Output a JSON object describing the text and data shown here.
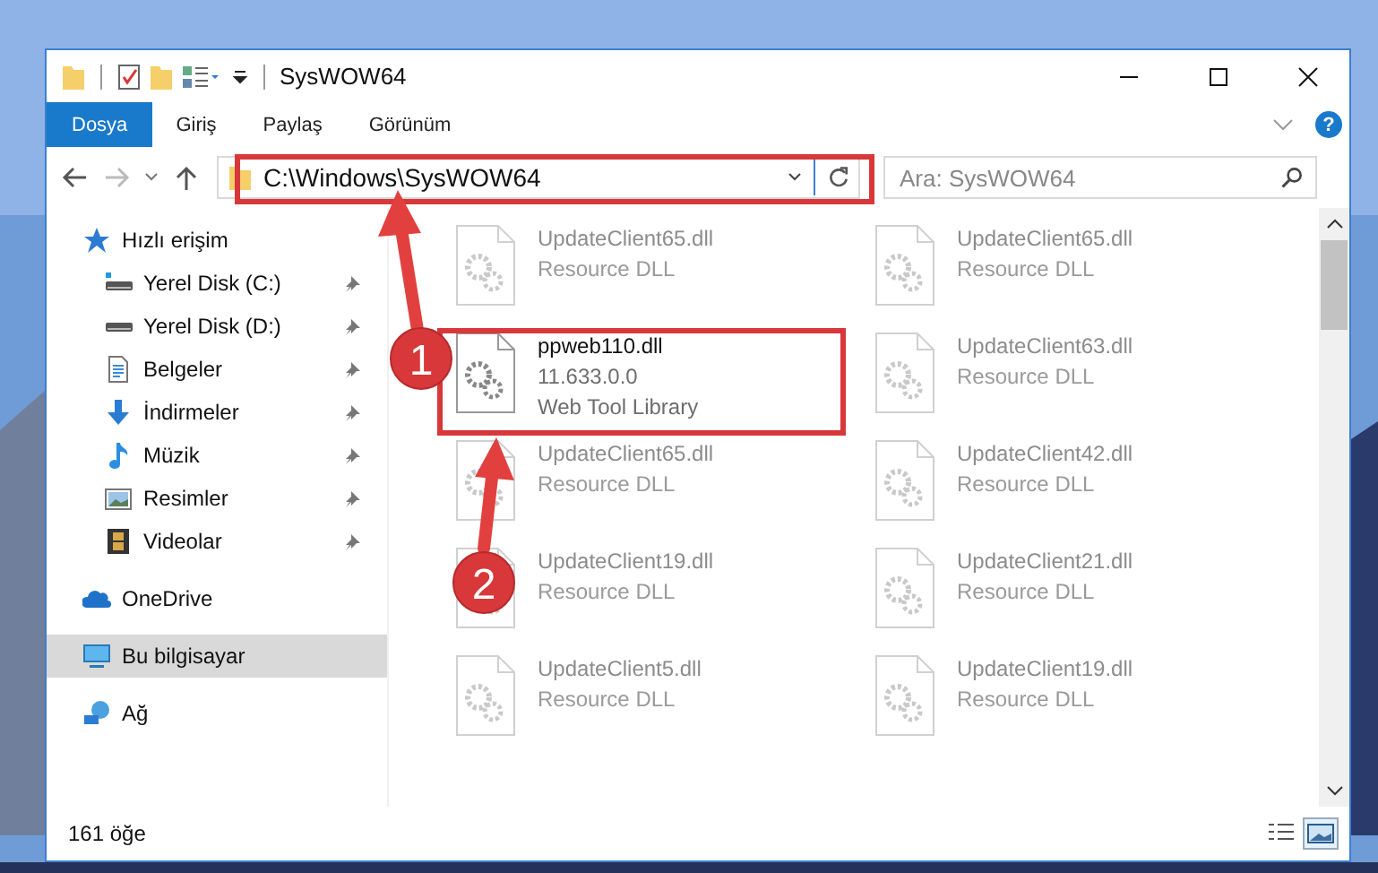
{
  "window": {
    "title": "SysWOW64"
  },
  "ribbon_tabs": [
    {
      "label": "Dosya",
      "selected": true
    },
    {
      "label": "Giriş",
      "selected": false
    },
    {
      "label": "Paylaş",
      "selected": false
    },
    {
      "label": "Görünüm",
      "selected": false
    }
  ],
  "help": "?",
  "address": {
    "path": "C:\\Windows\\SysWOW64"
  },
  "search": {
    "placeholder": "Ara: SysWOW64"
  },
  "sidebar": {
    "sections": [
      {
        "label": "Hızlı erişim",
        "kind": "star",
        "selected": false,
        "children": [
          {
            "label": "Yerel Disk (C:)",
            "kind": "drive-windows",
            "pinned": true,
            "selected": false
          },
          {
            "label": "Yerel Disk (D:)",
            "kind": "drive",
            "pinned": true,
            "selected": false
          },
          {
            "label": "Belgeler",
            "kind": "document",
            "pinned": true,
            "selected": false
          },
          {
            "label": "İndirmeler",
            "kind": "download",
            "pinned": true,
            "selected": false
          },
          {
            "label": "Müzik",
            "kind": "music",
            "pinned": true,
            "selected": false
          },
          {
            "label": "Resimler",
            "kind": "pictures",
            "pinned": true,
            "selected": false
          },
          {
            "label": "Videolar",
            "kind": "videos",
            "pinned": true,
            "selected": false
          }
        ]
      },
      {
        "label": "OneDrive",
        "kind": "cloud",
        "selected": false
      },
      {
        "label": "Bu bilgisayar",
        "kind": "computer",
        "selected": true
      },
      {
        "label": "Ağ",
        "kind": "network",
        "selected": false
      }
    ]
  },
  "files": [
    {
      "name": "UpdateClient65.dll",
      "details": [
        "Resource DLL"
      ],
      "blurred": true
    },
    {
      "name": "UpdateClient65.dll",
      "details": [
        "Resource DLL"
      ],
      "blurred": true
    },
    {
      "name": "ppweb110.dll",
      "details": [
        "11.633.0.0",
        "Web Tool Library"
      ],
      "blurred": false
    },
    {
      "name": "UpdateClient63.dll",
      "details": [
        "Resource DLL"
      ],
      "blurred": true
    },
    {
      "name": "UpdateClient65.dll",
      "details": [
        "Resource DLL"
      ],
      "blurred": true
    },
    {
      "name": "UpdateClient42.dll",
      "details": [
        "Resource DLL"
      ],
      "blurred": true
    },
    {
      "name": "UpdateClient19.dll",
      "details": [
        "Resource DLL"
      ],
      "blurred": true
    },
    {
      "name": "UpdateClient21.dll",
      "details": [
        "Resource DLL"
      ],
      "blurred": true
    },
    {
      "name": "UpdateClient5.dll",
      "details": [
        "Resource DLL"
      ],
      "blurred": true
    },
    {
      "name": "UpdateClient19.dll",
      "details": [
        "Resource DLL"
      ],
      "blurred": true
    }
  ],
  "status_bar": {
    "count": "161 öğe",
    "view_buttons": [
      {
        "kind": "details",
        "selected": false
      },
      {
        "kind": "large-icons",
        "selected": true
      }
    ]
  },
  "annotations": [
    {
      "number": "1"
    },
    {
      "number": "2"
    }
  ]
}
